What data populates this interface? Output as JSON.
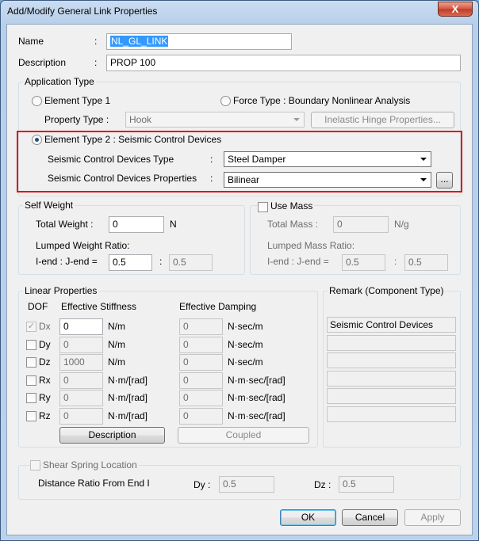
{
  "window": {
    "title": "Add/Modify General Link Properties",
    "close_glyph": "X"
  },
  "name": {
    "label": "Name",
    "colon": ":",
    "value": "NL_GL_LINK"
  },
  "description": {
    "label": "Description",
    "colon": ":",
    "value": "PROP 100"
  },
  "application_type": {
    "title": "Application Type",
    "element_type_1": "Element Type 1",
    "force_type": "Force Type : Boundary Nonlinear Analysis",
    "property_type_label": "Property Type :",
    "property_type_value": "Hook",
    "inelastic_button": "Inelastic Hinge Properties...",
    "element_type_2": "Element Type 2 : Seismic Control Devices",
    "scd_type_label": "Seismic Control Devices Type",
    "scd_type_colon": ":",
    "scd_type_value": "Steel Damper",
    "scd_props_label": "Seismic Control Devices Properties",
    "scd_props_colon": ":",
    "scd_props_value": "Bilinear",
    "ellipsis_button": "..."
  },
  "self_weight": {
    "title": "Self Weight",
    "total_label": "Total Weight :",
    "total_value": "0",
    "unit": "N",
    "lumped_label": "Lumped Weight Ratio:",
    "iend_label": "I-end : J-end =",
    "i_value": "0.5",
    "colon": ":",
    "j_value": "0.5"
  },
  "mass": {
    "title": "Use Mass",
    "total_label": "Total Mass :",
    "total_value": "0",
    "unit": "N/g",
    "lumped_label": "Lumped Mass Ratio:",
    "iend_label": "I-end : J-end =",
    "i_value": "0.5",
    "colon": ":",
    "j_value": "0.5"
  },
  "linear": {
    "title": "Linear Properties",
    "col_dof": "DOF",
    "col_stiffness": "Effective Stiffness",
    "col_damping": "Effective Damping",
    "rows": [
      {
        "dof": "Dx",
        "checked": "✓",
        "stiffness": "0",
        "s_unit": "N/m",
        "damping": "0",
        "d_unit": "N·sec/m"
      },
      {
        "dof": "Dy",
        "checked": "",
        "stiffness": "0",
        "s_unit": "N/m",
        "damping": "0",
        "d_unit": "N·sec/m"
      },
      {
        "dof": "Dz",
        "checked": "",
        "stiffness": "1000",
        "s_unit": "N/m",
        "damping": "0",
        "d_unit": "N·sec/m"
      },
      {
        "dof": "Rx",
        "checked": "",
        "stiffness": "0",
        "s_unit": "N·m/[rad]",
        "damping": "0",
        "d_unit": "N·m·sec/[rad]"
      },
      {
        "dof": "Ry",
        "checked": "",
        "stiffness": "0",
        "s_unit": "N·m/[rad]",
        "damping": "0",
        "d_unit": "N·m·sec/[rad]"
      },
      {
        "dof": "Rz",
        "checked": "",
        "stiffness": "0",
        "s_unit": "N·m/[rad]",
        "damping": "0",
        "d_unit": "N·m·sec/[rad]"
      }
    ],
    "description_button": "Description",
    "coupled_button": "Coupled"
  },
  "remark": {
    "title": "Remark (Component Type)",
    "cells": [
      "Seismic Control Devices",
      "",
      "",
      "",
      "",
      ""
    ]
  },
  "shear": {
    "title": "Shear Spring Location",
    "distance_label": "Distance Ratio From End I",
    "dy_label": "Dy :",
    "dy_value": "0.5",
    "dz_label": "Dz :",
    "dz_value": "0.5"
  },
  "buttons": {
    "ok": "OK",
    "cancel": "Cancel",
    "apply": "Apply"
  }
}
